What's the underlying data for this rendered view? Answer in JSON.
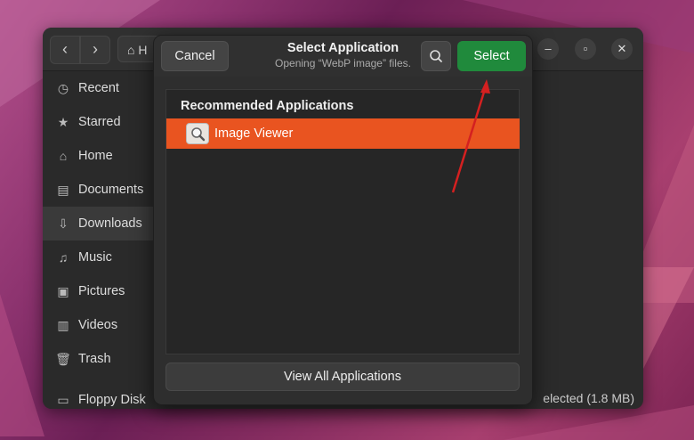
{
  "files_window": {
    "nav_back": "‹",
    "nav_forward": "›",
    "path_label": "H",
    "sidebar": [
      {
        "label": "Recent",
        "icon": "clock-icon"
      },
      {
        "label": "Starred",
        "icon": "star-icon"
      },
      {
        "label": "Home",
        "icon": "home-icon"
      },
      {
        "label": "Documents",
        "icon": "document-icon"
      },
      {
        "label": "Downloads",
        "icon": "download-icon"
      },
      {
        "label": "Music",
        "icon": "music-icon"
      },
      {
        "label": "Pictures",
        "icon": "picture-icon"
      },
      {
        "label": "Videos",
        "icon": "video-icon"
      },
      {
        "label": "Trash",
        "icon": "trash-icon"
      },
      {
        "label": "Floppy Disk",
        "icon": "floppy-icon"
      }
    ],
    "status": "elected  (1.8 MB)"
  },
  "dialog": {
    "title": "Select Application",
    "subtitle": "Opening “WebP image” files.",
    "cancel_label": "Cancel",
    "select_label": "Select",
    "list_heading": "Recommended Applications",
    "apps": [
      {
        "label": "Image Viewer",
        "icon": "image-viewer-icon",
        "selected": true
      }
    ],
    "view_all_label": "View All Applications"
  },
  "colors": {
    "accent_selected": "#e95420",
    "select_button": "#208a3c",
    "annotation_arrow": "#d42020"
  }
}
